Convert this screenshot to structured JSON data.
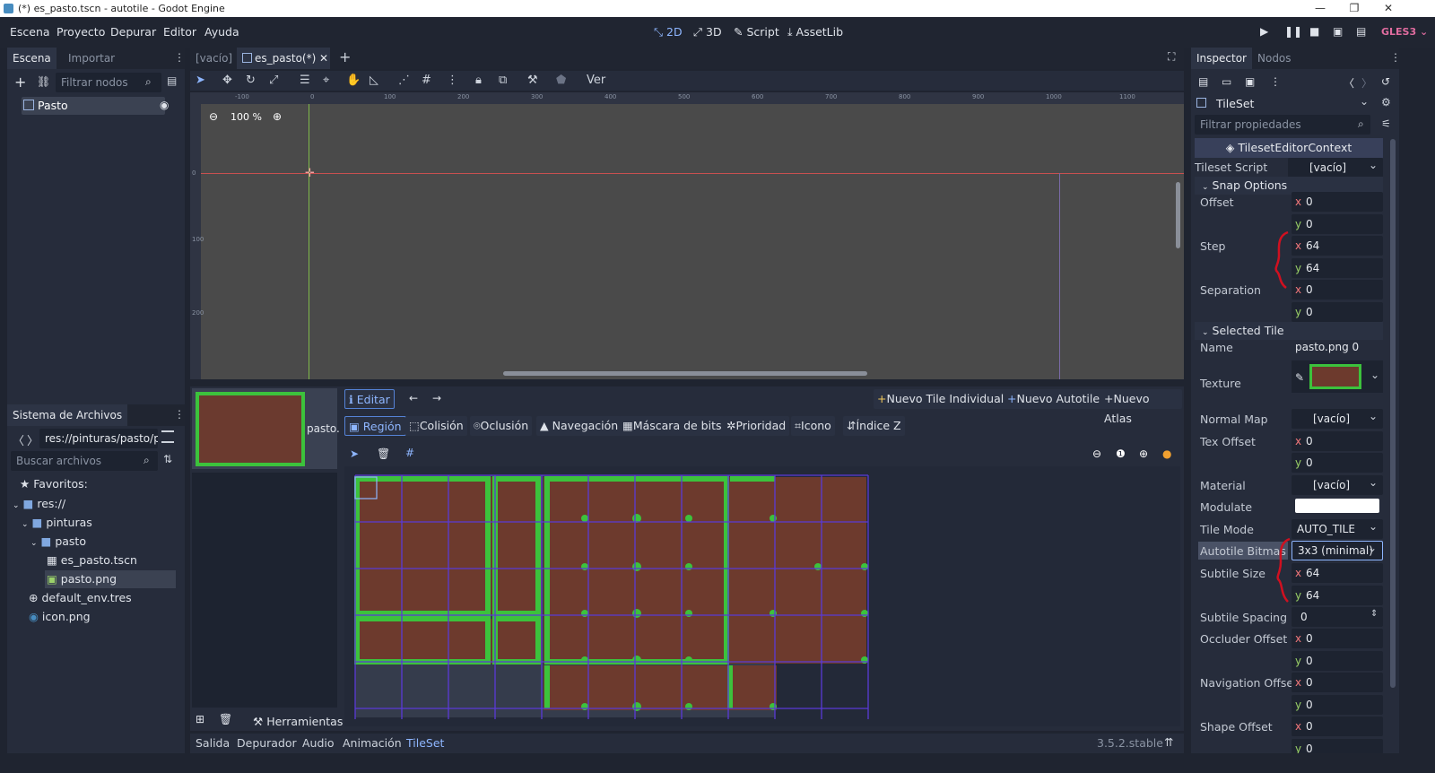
{
  "window": {
    "title": "(*) es_pasto.tscn - autotile - Godot Engine"
  },
  "menu": {
    "items": [
      "Escena",
      "Proyecto",
      "Depurar",
      "Editor",
      "Ayuda"
    ]
  },
  "workspaces": {
    "two_d": "2D",
    "three_d": "3D",
    "script": "Script",
    "assetlib": "AssetLib"
  },
  "renderer": "GLES3",
  "scene_dock": {
    "tabs": [
      "Escena",
      "Importar"
    ],
    "filter_placeholder": "Filtrar nodos",
    "root_node": "Pasto"
  },
  "filesystem_dock": {
    "title": "Sistema de Archivos",
    "path": "res://pinturas/pasto/p",
    "search_placeholder": "Buscar archivos",
    "items": [
      "Favoritos:",
      "res://",
      "pinturas",
      "pasto",
      "es_pasto.tscn",
      "pasto.png",
      "default_env.tres",
      "icon.png"
    ]
  },
  "editor_tabs": {
    "empty": "[vacío]",
    "current": "es_pasto(*)"
  },
  "toolbar": {
    "view": "Ver"
  },
  "viewport": {
    "zoom": "100 %",
    "ruler_x": [
      "-100",
      "0",
      "100",
      "200",
      "300",
      "400",
      "500",
      "600",
      "700",
      "800",
      "900",
      "1000",
      "1100"
    ],
    "ruler_y": [
      "0",
      "100",
      "200"
    ]
  },
  "tileset_editor": {
    "texture_label": "pasto.",
    "edit_button": "Editar",
    "new_single": "Nuevo Tile Individual",
    "new_autotile": "Nuevo Autotile",
    "new_atlas": "Nuevo Atlas",
    "modes": [
      "Región",
      "Colisión",
      "Oclusión",
      "Navegación",
      "Máscara de bits",
      "Prioridad",
      "Icono",
      "Índice Z"
    ],
    "tools_label": "Herramientas"
  },
  "bottom_panel": {
    "tabs": [
      "Salida",
      "Depurador",
      "Audio",
      "Animación",
      "TileSet"
    ],
    "version": "3.5.2.stable"
  },
  "inspector": {
    "tabs": [
      "Inspector",
      "Nodos"
    ],
    "resource": "TileSet",
    "filter_placeholder": "Filtrar propiedades",
    "context": "TilesetEditorContext",
    "tileset_script_label": "Tileset Script",
    "tileset_script_value": "[vacío]",
    "snap_section": "Snap Options",
    "offset_label": "Offset",
    "offset_x": "0",
    "offset_y": "0",
    "step_label": "Step",
    "step_x": "64",
    "step_y": "64",
    "separation_label": "Separation",
    "separation_x": "0",
    "separation_y": "0",
    "selected_section": "Selected Tile",
    "name_label": "Name",
    "name_value": "pasto.png 0",
    "texture_label": "Texture",
    "normal_map_label": "Normal Map",
    "normal_map_value": "[vacío]",
    "tex_offset_label": "Tex Offset",
    "tex_offset_x": "0",
    "tex_offset_y": "0",
    "material_label": "Material",
    "material_value": "[vacío]",
    "modulate_label": "Modulate",
    "tile_mode_label": "Tile Mode",
    "tile_mode_value": "AUTO_TILE",
    "bitmask_label": "Autotile Bitmask",
    "bitmask_value": "3x3 (minimal)",
    "subtile_size_label": "Subtile Size",
    "subtile_x": "64",
    "subtile_y": "64",
    "subtile_spacing_label": "Subtile Spacing",
    "subtile_spacing_value": "0",
    "occluder_label": "Occluder Offset",
    "occluder_x": "0",
    "occluder_y": "0",
    "nav_label": "Navigation Offset",
    "nav_x": "0",
    "nav_y": "0",
    "shape_label": "Shape Offset",
    "shape_x": "0",
    "shape_y": "0",
    "xl": "x",
    "yl": "y"
  },
  "colors": {
    "accent": "#8eb6ff",
    "x_axis": "#f2777a",
    "y_axis": "#99d066",
    "annotation": "#d01020"
  }
}
